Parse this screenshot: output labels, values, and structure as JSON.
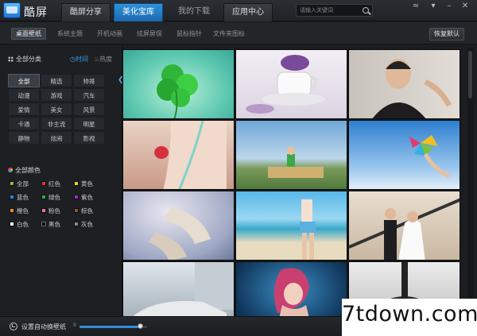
{
  "app": {
    "title": "酷屏"
  },
  "main_tabs": [
    {
      "label": "酷屏分享",
      "state": "inactive"
    },
    {
      "label": "美化宝库",
      "state": "active"
    },
    {
      "label": "我的下载",
      "state": "plain"
    },
    {
      "label": "应用中心",
      "state": "inactive"
    }
  ],
  "search": {
    "placeholder": "请输入关键词"
  },
  "window_controls": [
    "wifi-icon",
    "menu-icon",
    "minimize-icon",
    "close-icon"
  ],
  "sub_tabs": [
    {
      "label": "桌面壁纸",
      "active": true
    },
    {
      "label": "系统主题",
      "active": false
    },
    {
      "label": "开机动画",
      "active": false
    },
    {
      "label": "炫屏屏保",
      "active": false
    },
    {
      "label": "鼠标指针",
      "active": false
    },
    {
      "label": "文件夹图标",
      "active": false
    }
  ],
  "restore_label": "恢复默认",
  "sidebar": {
    "all_categories": "全部分类",
    "sort_time": "时间",
    "sort_hot": "热度",
    "categories": [
      "全部",
      "精选",
      "帅哥",
      "动漫",
      "游戏",
      "汽车",
      "爱情",
      "美女",
      "风景",
      "卡通",
      "非主流",
      "明星",
      "静物",
      "炫闹",
      "影视"
    ],
    "selected_category": "全部",
    "all_colors": "全部颜色",
    "colors": [
      {
        "label": "全部",
        "color": "#8a8f96"
      },
      {
        "label": "红色",
        "color": "#e03030"
      },
      {
        "label": "黄色",
        "color": "#f0d020"
      },
      {
        "label": "蓝色",
        "color": "#2f7fe0"
      },
      {
        "label": "绿色",
        "color": "#30b040"
      },
      {
        "label": "紫色",
        "color": "#a030c0"
      },
      {
        "label": "橙色",
        "color": "#f08a20"
      },
      {
        "label": "粉色",
        "color": "#f070b0"
      },
      {
        "label": "棕色",
        "color": "#8a5a2a"
      },
      {
        "label": "白色",
        "color": "#ffffff"
      },
      {
        "label": "黑色",
        "color": "#111111"
      },
      {
        "label": "灰色",
        "color": "#8a8a8a"
      }
    ]
  },
  "bottom": {
    "auto_wallpaper": "设置自动换壁纸",
    "slider_min": "8",
    "interval_level": 0.9
  },
  "watermark": "7tdown.com"
}
